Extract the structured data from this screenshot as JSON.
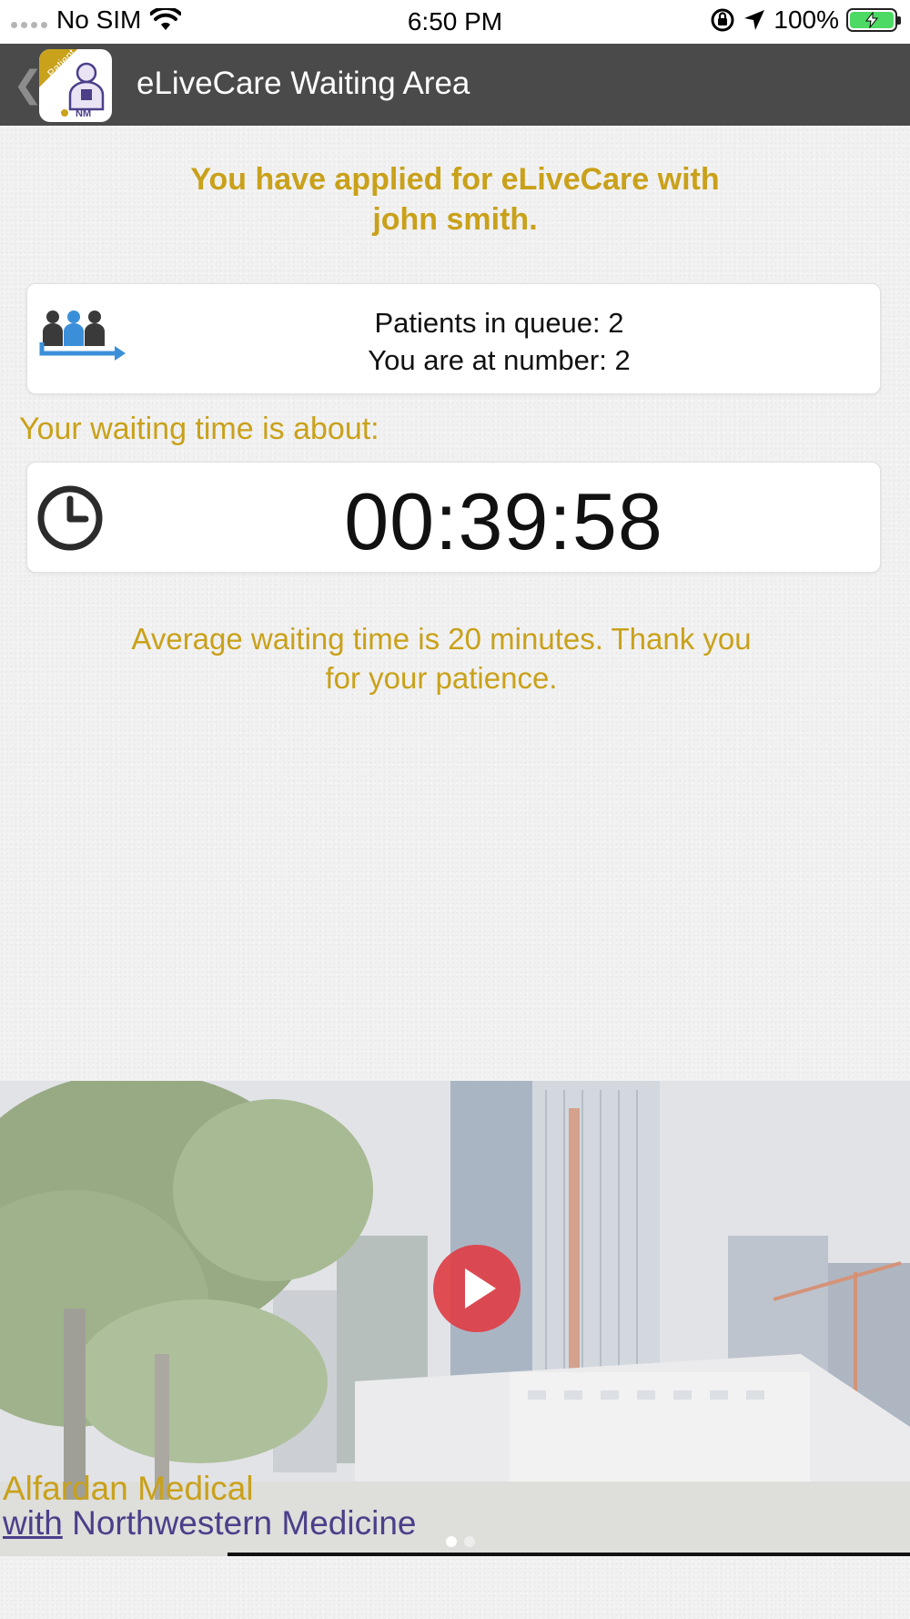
{
  "status_bar": {
    "carrier": "No SIM",
    "time": "6:50 PM",
    "battery": "100%"
  },
  "nav": {
    "title": "eLiveCare Waiting Area",
    "logo_badge": "Patient",
    "logo_mark": "NM"
  },
  "content": {
    "applied_line1": "You have applied for eLiveCare with",
    "applied_line2": "john smith.",
    "queue_line1": "Patients in queue: 2",
    "queue_line2": "You are at number: 2",
    "waiting_label": "Your waiting time is about:",
    "timer": "00:39:58",
    "avg_line1": "Average waiting time is 20 minutes. Thank you",
    "avg_line2": "for your patience."
  },
  "video": {
    "caption_line1": "Alfardan Medical",
    "caption_with": "with",
    "caption_rest": " Northwestern Medicine"
  },
  "colors": {
    "accent": "#c9a11a",
    "nav_bg": "#4a4a4a",
    "play": "#de4046",
    "brand_purple": "#4b3f8a"
  }
}
